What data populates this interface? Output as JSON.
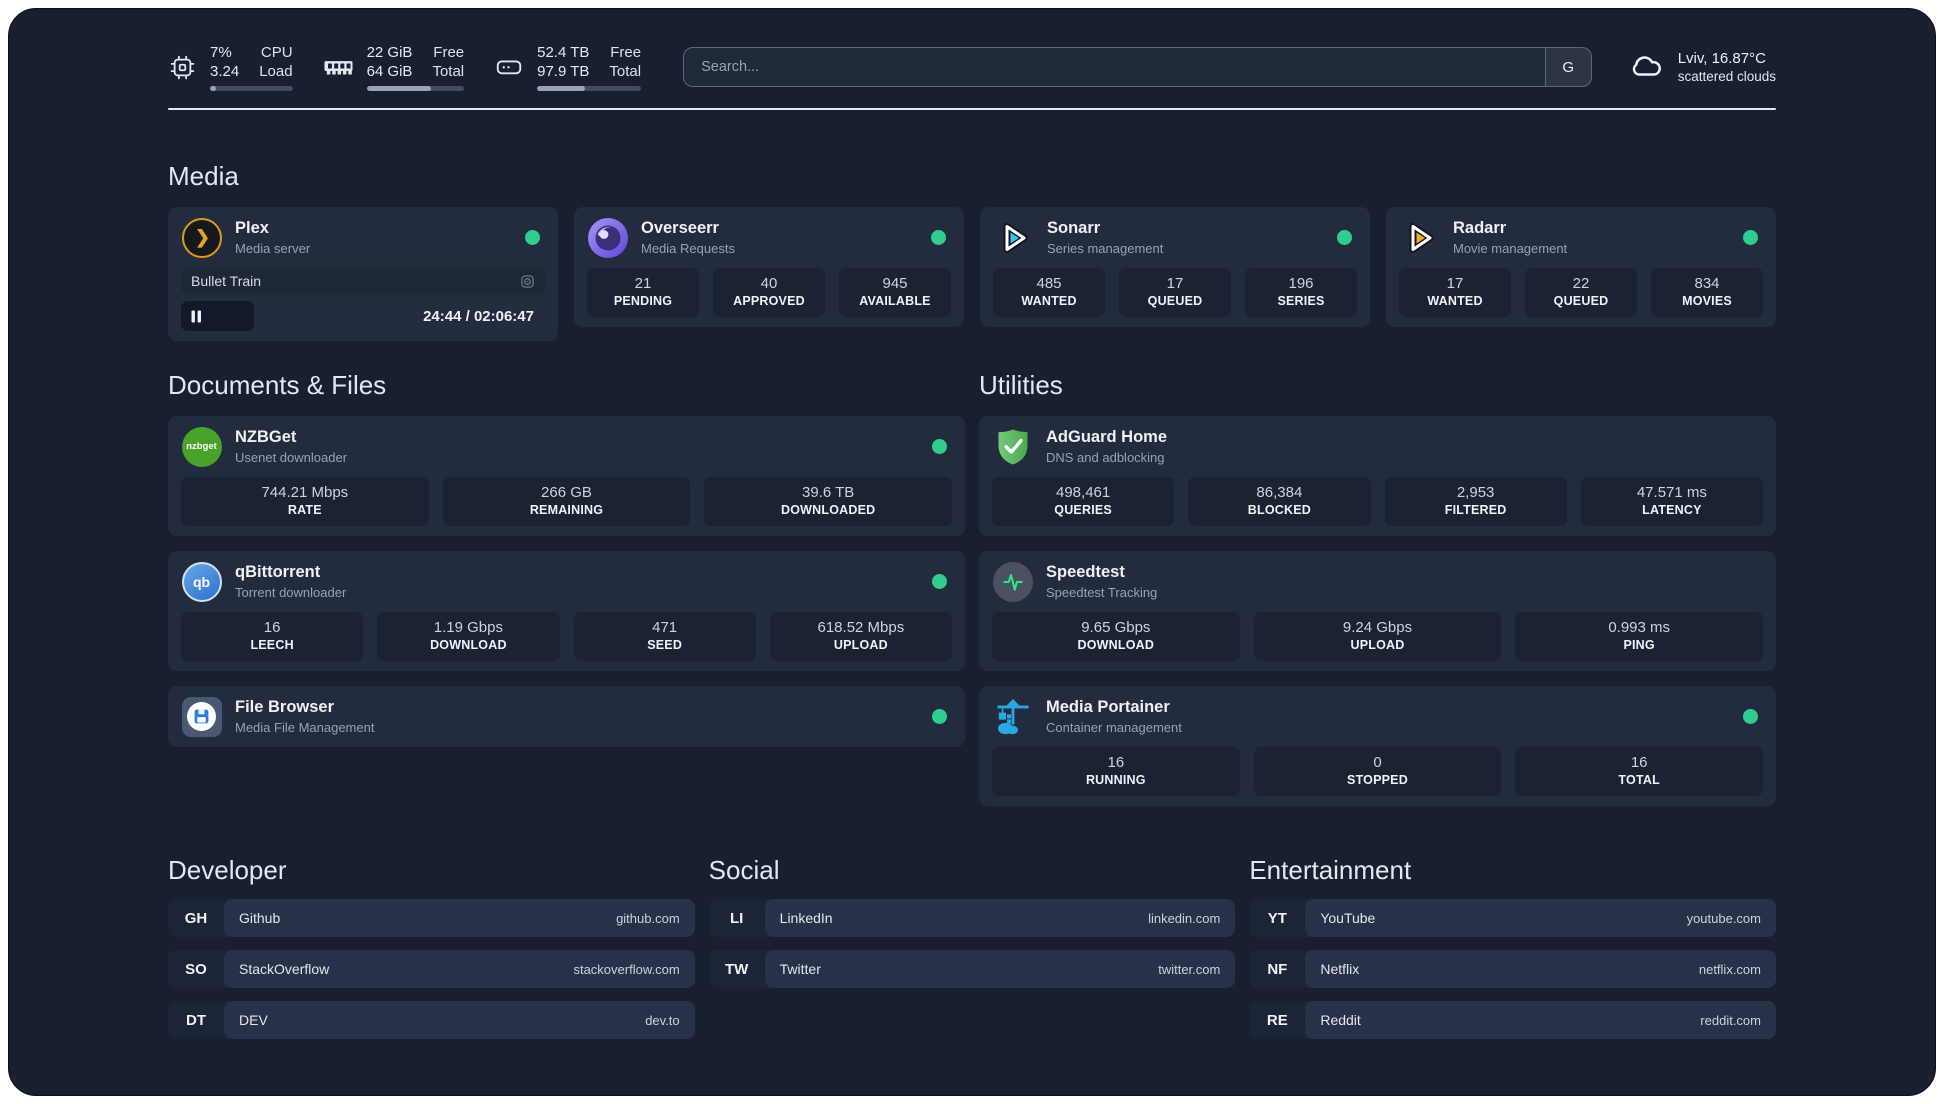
{
  "topbar": {
    "resources": [
      {
        "kind": "cpu",
        "icon": "cpu-icon",
        "values": [
          "7%",
          "3.24"
        ],
        "labels": [
          "CPU",
          "Load"
        ],
        "progress_percent": 7
      },
      {
        "kind": "memory",
        "icon": "memory-icon",
        "values": [
          "22 GiB",
          "64 GiB"
        ],
        "labels": [
          "Free",
          "Total"
        ],
        "progress_percent": 66
      },
      {
        "kind": "disk",
        "icon": "disk-icon",
        "values": [
          "52.4 TB",
          "97.9 TB"
        ],
        "labels": [
          "Free",
          "Total"
        ],
        "progress_percent": 46
      }
    ],
    "search": {
      "placeholder": "Search...",
      "provider_button": "G"
    },
    "weather": {
      "icon": "cloud-icon",
      "location": "Lviv, 16.87°C",
      "condition": "scattered clouds"
    }
  },
  "sections": {
    "media": {
      "title": "Media",
      "services": [
        {
          "icon": "plex-icon",
          "name": "Plex",
          "description": "Media server",
          "status_dot": true,
          "now_playing": {
            "title": "Bullet Train",
            "state": "paused",
            "time": "24:44 / 02:06:47",
            "progress_percent": 20
          }
        },
        {
          "icon": "overseerr-icon",
          "name": "Overseerr",
          "description": "Media Requests",
          "status_dot": true,
          "stats": [
            {
              "value": "21",
              "label": "PENDING"
            },
            {
              "value": "40",
              "label": "APPROVED"
            },
            {
              "value": "945",
              "label": "AVAILABLE"
            }
          ]
        },
        {
          "icon": "sonarr-icon",
          "name": "Sonarr",
          "description": "Series management",
          "status_dot": true,
          "stats": [
            {
              "value": "485",
              "label": "WANTED"
            },
            {
              "value": "17",
              "label": "QUEUED"
            },
            {
              "value": "196",
              "label": "SERIES"
            }
          ]
        },
        {
          "icon": "radarr-icon",
          "name": "Radarr",
          "description": "Movie management",
          "status_dot": true,
          "stats": [
            {
              "value": "17",
              "label": "WANTED"
            },
            {
              "value": "22",
              "label": "QUEUED"
            },
            {
              "value": "834",
              "label": "MOVIES"
            }
          ]
        }
      ]
    },
    "documents": {
      "title": "Documents & Files",
      "services": [
        {
          "icon": "nzbget-icon",
          "name": "NZBGet",
          "description": "Usenet downloader",
          "status_dot": true,
          "stats": [
            {
              "value": "744.21 Mbps",
              "label": "RATE"
            },
            {
              "value": "266 GB",
              "label": "REMAINING"
            },
            {
              "value": "39.6 TB",
              "label": "DOWNLOADED"
            }
          ]
        },
        {
          "icon": "qbittorrent-icon",
          "name": "qBittorrent",
          "description": "Torrent downloader",
          "status_dot": true,
          "stats": [
            {
              "value": "16",
              "label": "LEECH"
            },
            {
              "value": "1.19 Gbps",
              "label": "DOWNLOAD"
            },
            {
              "value": "471",
              "label": "SEED"
            },
            {
              "value": "618.52 Mbps",
              "label": "UPLOAD"
            }
          ]
        },
        {
          "icon": "filebrowser-icon",
          "name": "File Browser",
          "description": "Media File Management",
          "status_dot": true
        }
      ]
    },
    "utilities": {
      "title": "Utilities",
      "services": [
        {
          "icon": "adguard-icon",
          "name": "AdGuard Home",
          "description": "DNS and adblocking",
          "status_dot": false,
          "stats": [
            {
              "value": "498,461",
              "label": "QUERIES"
            },
            {
              "value": "86,384",
              "label": "BLOCKED"
            },
            {
              "value": "2,953",
              "label": "FILTERED"
            },
            {
              "value": "47.571 ms",
              "label": "LATENCY"
            }
          ]
        },
        {
          "icon": "speedtest-icon",
          "name": "Speedtest",
          "description": "Speedtest Tracking",
          "status_dot": false,
          "stats": [
            {
              "value": "9.65 Gbps",
              "label": "DOWNLOAD"
            },
            {
              "value": "9.24 Gbps",
              "label": "UPLOAD"
            },
            {
              "value": "0.993 ms",
              "label": "PING"
            }
          ]
        },
        {
          "icon": "portainer-icon",
          "name": "Media Portainer",
          "description": "Container management",
          "status_dot": true,
          "stats": [
            {
              "value": "16",
              "label": "RUNNING"
            },
            {
              "value": "0",
              "label": "STOPPED"
            },
            {
              "value": "16",
              "label": "TOTAL"
            }
          ]
        }
      ]
    }
  },
  "bookmark_groups": [
    {
      "title": "Developer",
      "links": [
        {
          "abbr": "GH",
          "name": "Github",
          "url": "github.com"
        },
        {
          "abbr": "SO",
          "name": "StackOverflow",
          "url": "stackoverflow.com"
        },
        {
          "abbr": "DT",
          "name": "DEV",
          "url": "dev.to"
        }
      ]
    },
    {
      "title": "Social",
      "links": [
        {
          "abbr": "LI",
          "name": "LinkedIn",
          "url": "linkedin.com"
        },
        {
          "abbr": "TW",
          "name": "Twitter",
          "url": "twitter.com"
        }
      ]
    },
    {
      "title": "Entertainment",
      "links": [
        {
          "abbr": "YT",
          "name": "YouTube",
          "url": "youtube.com"
        },
        {
          "abbr": "NF",
          "name": "Netflix",
          "url": "netflix.com"
        },
        {
          "abbr": "RE",
          "name": "Reddit",
          "url": "reddit.com"
        }
      ]
    }
  ],
  "colors": {
    "status_online": "#2fcd8e",
    "background": "#181f31",
    "card": "#232c3e"
  }
}
